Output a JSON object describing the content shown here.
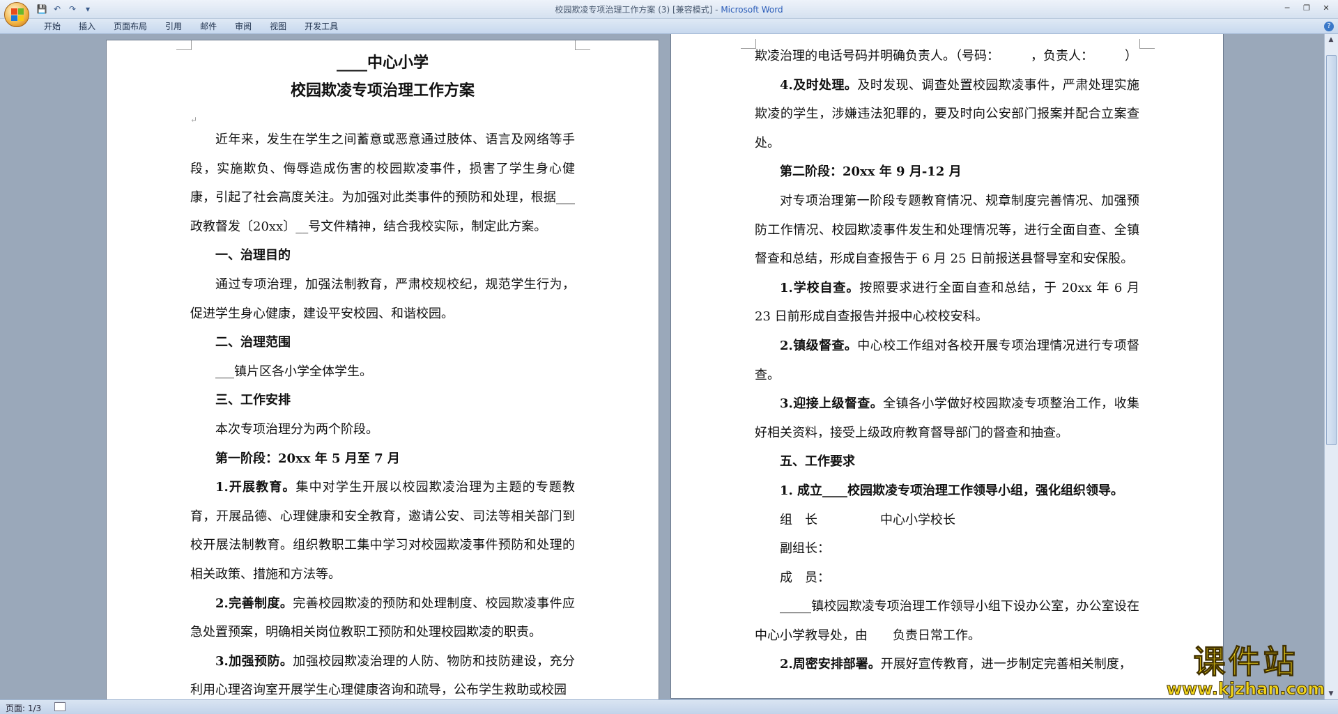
{
  "window": {
    "title": "校园欺凌专项治理工作方案 (3) [兼容模式] - ",
    "app": "Microsoft Word"
  },
  "ribbon": {
    "tabs": [
      "开始",
      "插入",
      "页面布局",
      "引用",
      "邮件",
      "审阅",
      "视图",
      "开发工具"
    ]
  },
  "page1": {
    "title1": "____中心小学",
    "title2": "校园欺凌专项治理工作方案",
    "p1": "近年来，发生在学生之间蓄意或恶意通过肢体、语言及网络等手段，实施欺负、侮辱造成伤害的校园欺凌事件，损害了学生身心健康，引起了社会高度关注。为加强对此类事件的预防和处理，根据___政教督发〔20xx〕__号文件精神，结合我校实际，制定此方案。",
    "h1": "一、治理目的",
    "p2": "通过专项治理，加强法制教育，严肃校规校纪，规范学生行为，促进学生身心健康，建设平安校园、和谐校园。",
    "h2": "二、治理范围",
    "p3": "___镇片区各小学全体学生。",
    "h3": "三、工作安排",
    "p4": "本次专项治理分为两个阶段。",
    "h4": "第一阶段：20xx 年 5 月至 7 月",
    "p5b": "1.开展教育。",
    "p5": "集中对学生开展以校园欺凌治理为主题的专题教育，开展品德、心理健康和安全教育，邀请公安、司法等相关部门到校开展法制教育。组织教职工集中学习对校园欺凌事件预防和处理的相关政策、措施和方法等。",
    "p6b": "2.完善制度。",
    "p6": "完善校园欺凌的预防和处理制度、校园欺凌事件应急处置预案，明确相关岗位教职工预防和处理校园欺凌的职责。",
    "p7b": "3.加强预防。",
    "p7": "加强校园欺凌治理的人防、物防和技防建设，充分利用心理咨询室开展学生心理健康咨询和疏导，公布学生救助或校园"
  },
  "page2": {
    "p0": "欺凌治理的电话号码并明确负责人。（号码：　　　，负责人：　　　）",
    "p1b": "4.及时处理。",
    "p1": "及时发现、调查处置校园欺凌事件，严肃处理实施欺凌的学生，涉嫌违法犯罪的，要及时向公安部门报案并配合立案查处。",
    "h1": "第二阶段：20xx 年 9 月-12 月",
    "p2": "对专项治理第一阶段专题教育情况、规章制度完善情况、加强预防工作情况、校园欺凌事件发生和处理情况等，进行全面自查、全镇督查和总结，形成自查报告于 6 月 25 日前报送县督导室和安保股。",
    "p3b": "1.学校自查。",
    "p3": "按照要求进行全面自查和总结，于 20xx 年 6 月 23 日前形成自查报告并报中心校校安科。",
    "p4b": "2.镇级督查。",
    "p4": "中心校工作组对各校开展专项治理情况进行专项督查。",
    "p5b": "3.迎接上级督查。",
    "p5": "全镇各小学做好校园欺凌专项整治工作，收集好相关资料，接受上级政府教育督导部门的督查和抽查。",
    "h2": "五、工作要求",
    "h3": "1. 成立____校园欺凌专项治理工作领导小组，强化组织领导。",
    "r1": "组　长　　　　　中心小学校长",
    "r2": "副组长：",
    "r3": "成　员：",
    "p6": "_____镇校园欺凌专项治理工作领导小组下设办公室，办公室设在中心小学教导处，由　　负责日常工作。",
    "p7b": "2.周密安排部署。",
    "p7": "开展好宣传教育，进一步制定完善相关制度，"
  },
  "status": {
    "page": "页面: 1/3"
  },
  "watermark": {
    "line1": "课件站",
    "line2": "www.kjzhan.com"
  }
}
